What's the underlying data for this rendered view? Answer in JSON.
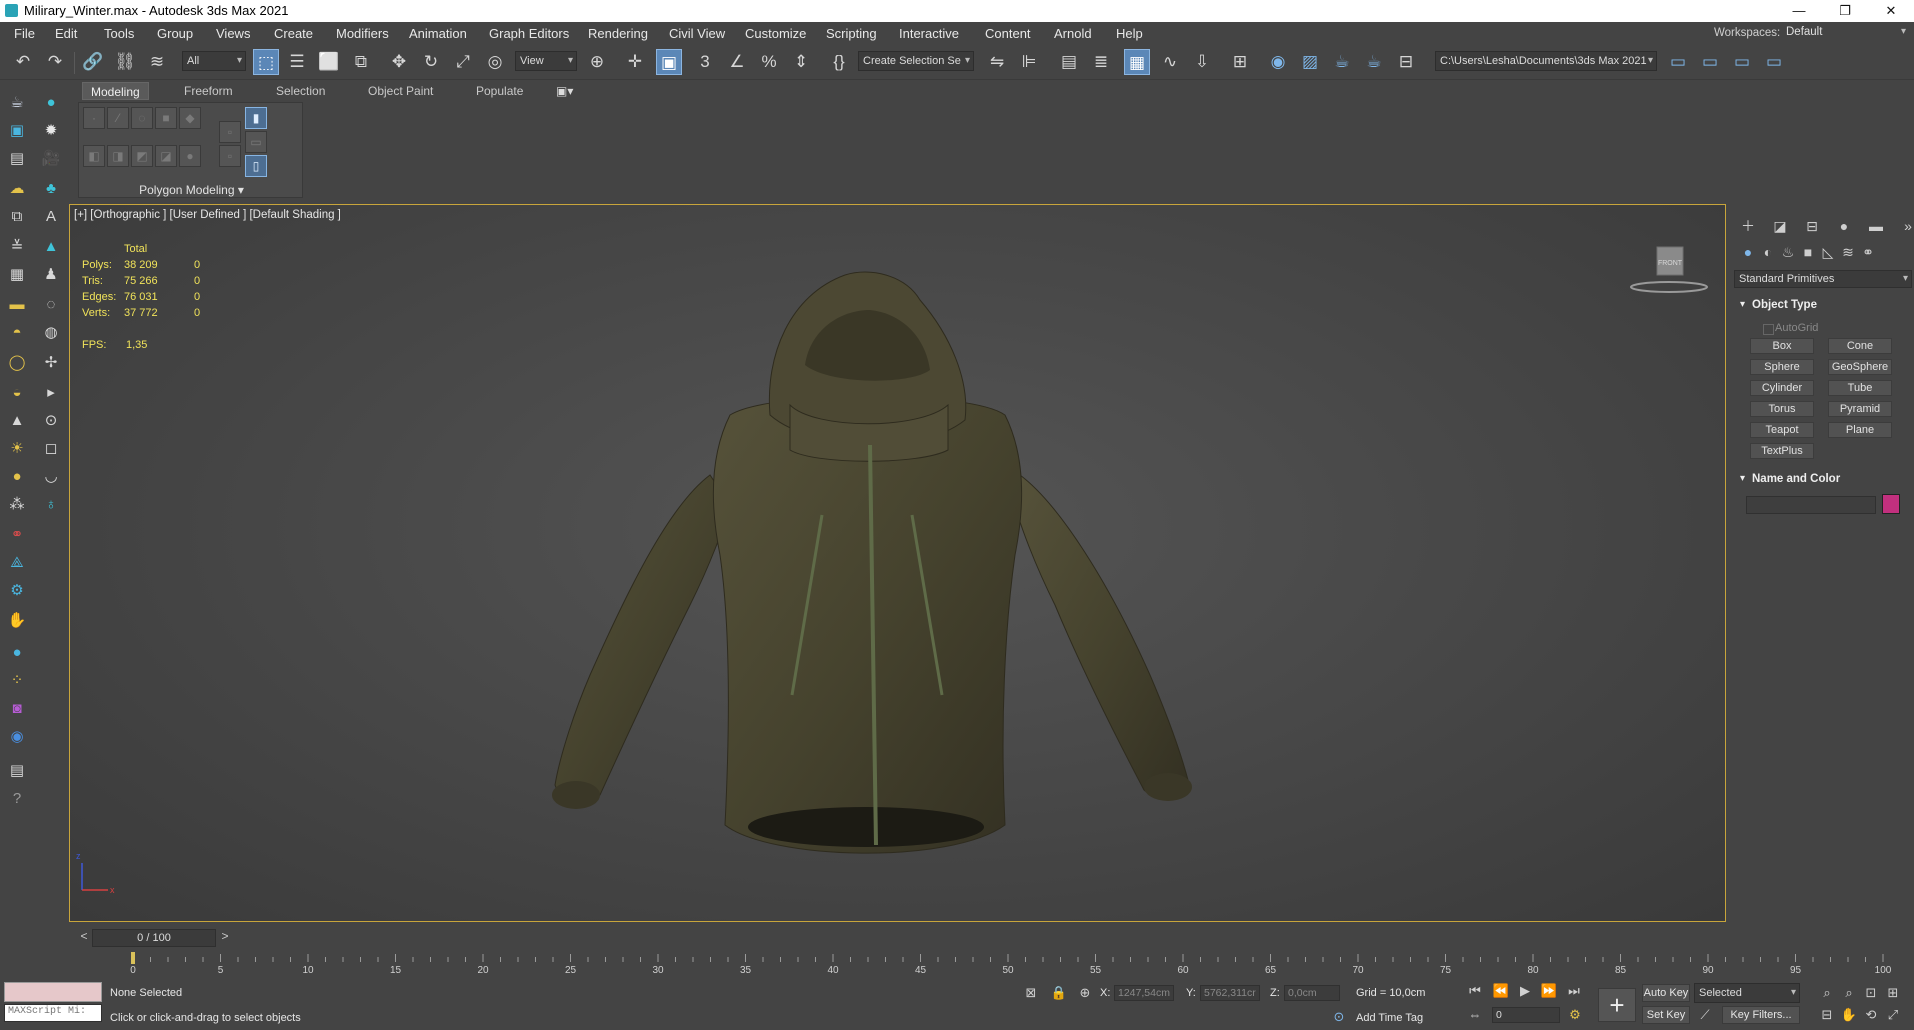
{
  "window": {
    "title": "Milirary_Winter.max - Autodesk 3ds Max 2021",
    "minimize": "—",
    "maximize": "❐",
    "close": "✕"
  },
  "menu": {
    "items": [
      "File",
      "Edit",
      "Tools",
      "Group",
      "Views",
      "Create",
      "Modifiers",
      "Animation",
      "Graph Editors",
      "Rendering",
      "Civil View",
      "Customize",
      "Scripting",
      "Interactive",
      "Content",
      "Arnold",
      "Help"
    ],
    "workspace_label": "Workspaces:",
    "workspace_value": "Default"
  },
  "toolbar": {
    "selection_filter": "All",
    "ref_coord": "View",
    "named_selection": "Create Selection Se",
    "project_path": "C:\\Users\\Lesha\\Documents\\3ds Max 2021",
    "icons": [
      "undo-icon",
      "redo-icon",
      "link-icon",
      "unlink-icon",
      "bind-space-warp-icon",
      "select-object-icon",
      "select-by-name-icon",
      "rect-selection-icon",
      "window-crossing-icon",
      "move-icon",
      "rotate-icon",
      "scale-icon",
      "placement-icon",
      "pivot-icon",
      "snap-3d-icon",
      "angle-snap-icon",
      "percent-snap-icon",
      "spinner-snap-icon",
      "edit-named-sets-icon",
      "mirror-icon",
      "align-icon",
      "layer-explorer-icon",
      "scene-explorer-icon",
      "ribbon-toggle-icon",
      "curve-editor-icon",
      "schematic-view-icon",
      "material-editor-icon",
      "render-setup-icon",
      "rendered-frame-icon",
      "render-icon"
    ]
  },
  "ribbon": {
    "tabs": [
      "Modeling",
      "Freeform",
      "Selection",
      "Object Paint",
      "Populate"
    ],
    "active_tab": "Modeling",
    "panel_label": "Polygon Modeling"
  },
  "viewport": {
    "label": "[+] [Orthographic ] [User Defined ] [Default Shading ]",
    "stats": {
      "header": "Total",
      "rows": [
        {
          "label": "Polys:",
          "total": "38 209",
          "sel": "0"
        },
        {
          "label": "Tris:",
          "total": "75 266",
          "sel": "0"
        },
        {
          "label": "Edges:",
          "total": "76 031",
          "sel": "0"
        },
        {
          "label": "Verts:",
          "total": "37 772",
          "sel": "0"
        }
      ],
      "fps_label": "FPS:",
      "fps_value": "1,35"
    },
    "viewcube_label": "FRONT"
  },
  "command_panel": {
    "category": "Standard Primitives",
    "object_type_title": "Object Type",
    "autogrid": "AutoGrid",
    "primitives": [
      "Box",
      "Cone",
      "Sphere",
      "GeoSphere",
      "Cylinder",
      "Tube",
      "Torus",
      "Pyramid",
      "Teapot",
      "Plane",
      "TextPlus"
    ],
    "name_color_title": "Name and Color",
    "object_name": "",
    "color": "#c2307e"
  },
  "timeline": {
    "slider_text": "0 / 100",
    "prev": "<",
    "next": ">",
    "ticks": [
      "0",
      "5",
      "10",
      "15",
      "20",
      "25",
      "30",
      "35",
      "40",
      "45",
      "50",
      "55",
      "60",
      "65",
      "70",
      "75",
      "80",
      "85",
      "90",
      "95",
      "100"
    ]
  },
  "status": {
    "maxscript": "MAXScript Mi:",
    "selection": "None Selected",
    "prompt": "Click or click-and-drag to select objects",
    "x_label": "X:",
    "x_value": "1247,54cm",
    "y_label": "Y:",
    "y_value": "5762,311cr",
    "z_label": "Z:",
    "z_value": "0,0cm",
    "grid": "Grid = 10,0cm",
    "add_time_tag": "Add Time Tag",
    "auto_key": "Auto Key",
    "set_key": "Set Key",
    "key_mode": "Selected",
    "key_filters": "Key Filters...",
    "frame": "0"
  },
  "colors": {
    "accent": "#5b87b7",
    "viewport_border": "#c8a53b",
    "stats_text": "#f1e35a",
    "jacket": "#48452f"
  }
}
